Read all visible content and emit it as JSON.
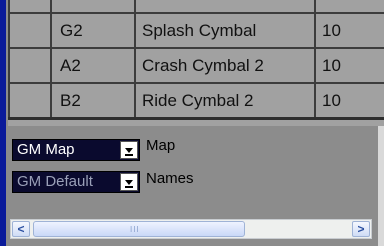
{
  "table": {
    "rows": [
      {
        "note": "G2",
        "name": "Splash Cymbal",
        "value": "10"
      },
      {
        "note": "A2",
        "name": "Crash Cymbal 2",
        "value": "10"
      },
      {
        "note": "B2",
        "name": "Ride Cymbal 2",
        "value": "10"
      }
    ]
  },
  "controls": {
    "map_combo": {
      "value": "GM Map",
      "label": "Map"
    },
    "names_combo": {
      "value": "GM Default",
      "label": "Names"
    }
  },
  "scrollbar": {
    "left_arrow": "<",
    "right_arrow": ">",
    "grip": "III"
  }
}
